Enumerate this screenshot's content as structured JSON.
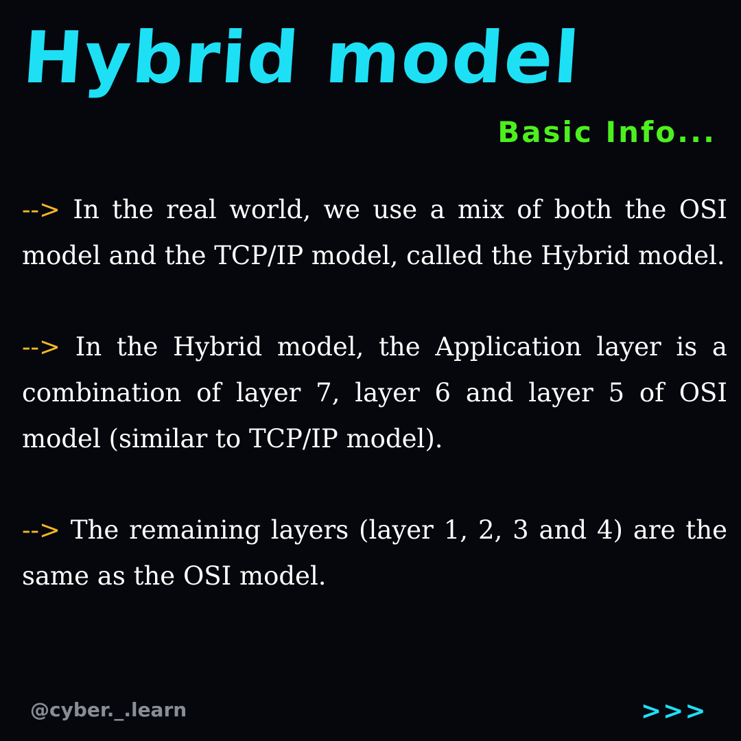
{
  "header": {
    "title": "Hybrid model",
    "subtitle": "Basic Info..."
  },
  "paragraphs": [
    {
      "marker": "-->",
      "text": " In the real world, we use a mix of both the OSI model and the TCP/IP model, called the Hybrid model."
    },
    {
      "marker": "-->",
      "text": " In the Hybrid model, the Application layer is a combination of layer 7, layer 6 and layer 5 of OSI model (similar to TCP/IP model)."
    },
    {
      "marker": "-->",
      "text": " The remaining layers (layer 1, 2, 3 and 4) are the same as the OSI model."
    }
  ],
  "footer": {
    "handle": "@cyber._.learn",
    "next": ">>>"
  },
  "colors": {
    "background": "#05070d",
    "title": "#1ee0f5",
    "subtitle": "#4cf01e",
    "marker": "#f6b526",
    "body_text": "#ffffff",
    "handle": "#8a8d94"
  }
}
